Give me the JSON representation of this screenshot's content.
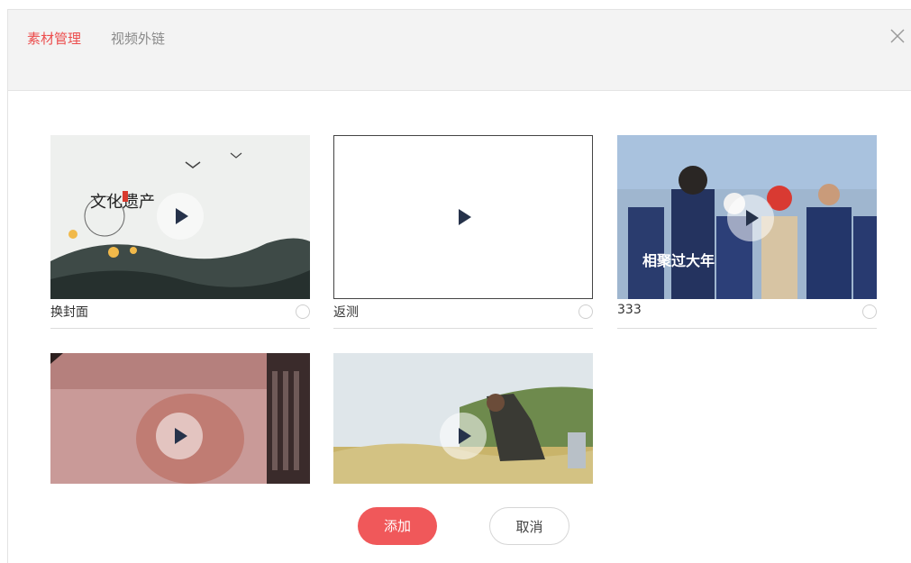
{
  "tabs": {
    "active": "素材管理",
    "inactive": "视频外链"
  },
  "icons": {
    "close": "close-icon",
    "play": "play-icon"
  },
  "colors": {
    "accent": "#ec4d4d",
    "button_add": "#f0585a"
  },
  "videos": [
    {
      "caption": "换封面",
      "thumbnail_text": "文化遗产",
      "selected": false
    },
    {
      "caption": "返测",
      "thumbnail_text": "",
      "selected": false
    },
    {
      "caption": "333",
      "thumbnail_text": "相聚过大年",
      "selected": false
    },
    {
      "caption": "",
      "selected": false
    },
    {
      "caption": "",
      "selected": false
    }
  ],
  "buttons": {
    "add": "添加",
    "cancel": "取消"
  }
}
